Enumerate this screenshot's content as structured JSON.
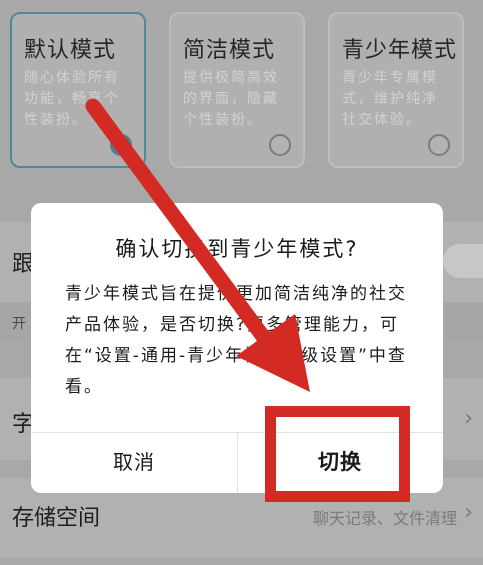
{
  "mode_cards": [
    {
      "title": "默认模式",
      "desc": "随心体验所有功能，畅享个性装扮。",
      "selected": true
    },
    {
      "title": "简洁模式",
      "desc": "提供极简高效的界面，隐藏个性装扮。",
      "selected": false
    },
    {
      "title": "青少年模式",
      "desc": "青少年专属模式，维护纯净社交体验。",
      "selected": false
    }
  ],
  "rows": {
    "follow_label": "跟",
    "open_label": "开",
    "font_label": "字",
    "storage_label": "存储空间",
    "storage_value": "聊天记录、文件清理"
  },
  "dialog": {
    "title": "确认切换到青少年模式?",
    "body": "青少年模式旨在提供更加简洁纯净的社交产品体验，是否切换?更多管理能力，可在“设置-通用-青少年模式高级设置”中查看。",
    "cancel_label": "取消",
    "confirm_label": "切换"
  },
  "colors": {
    "annotation_red": "#d42a24",
    "selected_accent": "#52889c"
  },
  "icons": {
    "chevron": "chevron-right-icon",
    "radio": "radio-icon"
  }
}
